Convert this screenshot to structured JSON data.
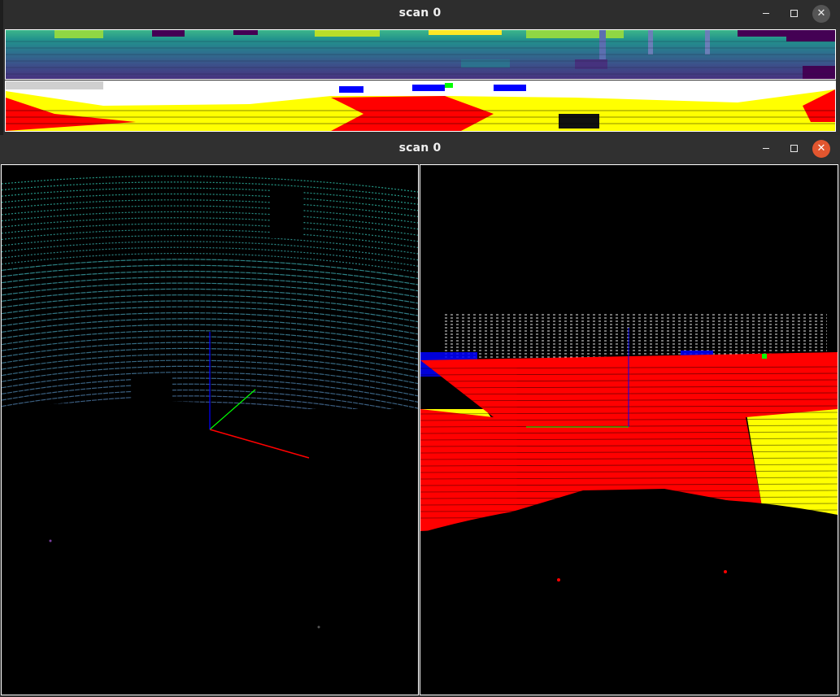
{
  "windows": [
    {
      "title": "scan 0"
    },
    {
      "title": "scan 0"
    }
  ],
  "colors": {
    "road": "#ff0000",
    "sidewalk": "#ffff00",
    "building": "#ffffff",
    "vehicle": "#0000ff",
    "vegetation": "#00ff00",
    "axis_x": "#ff0000",
    "axis_y": "#00ff00",
    "axis_z": "#0000ff",
    "close_active": "#e2562f"
  },
  "icons": {
    "minimize": "minimize-icon",
    "maximize": "maximize-icon",
    "close": "close-icon"
  }
}
